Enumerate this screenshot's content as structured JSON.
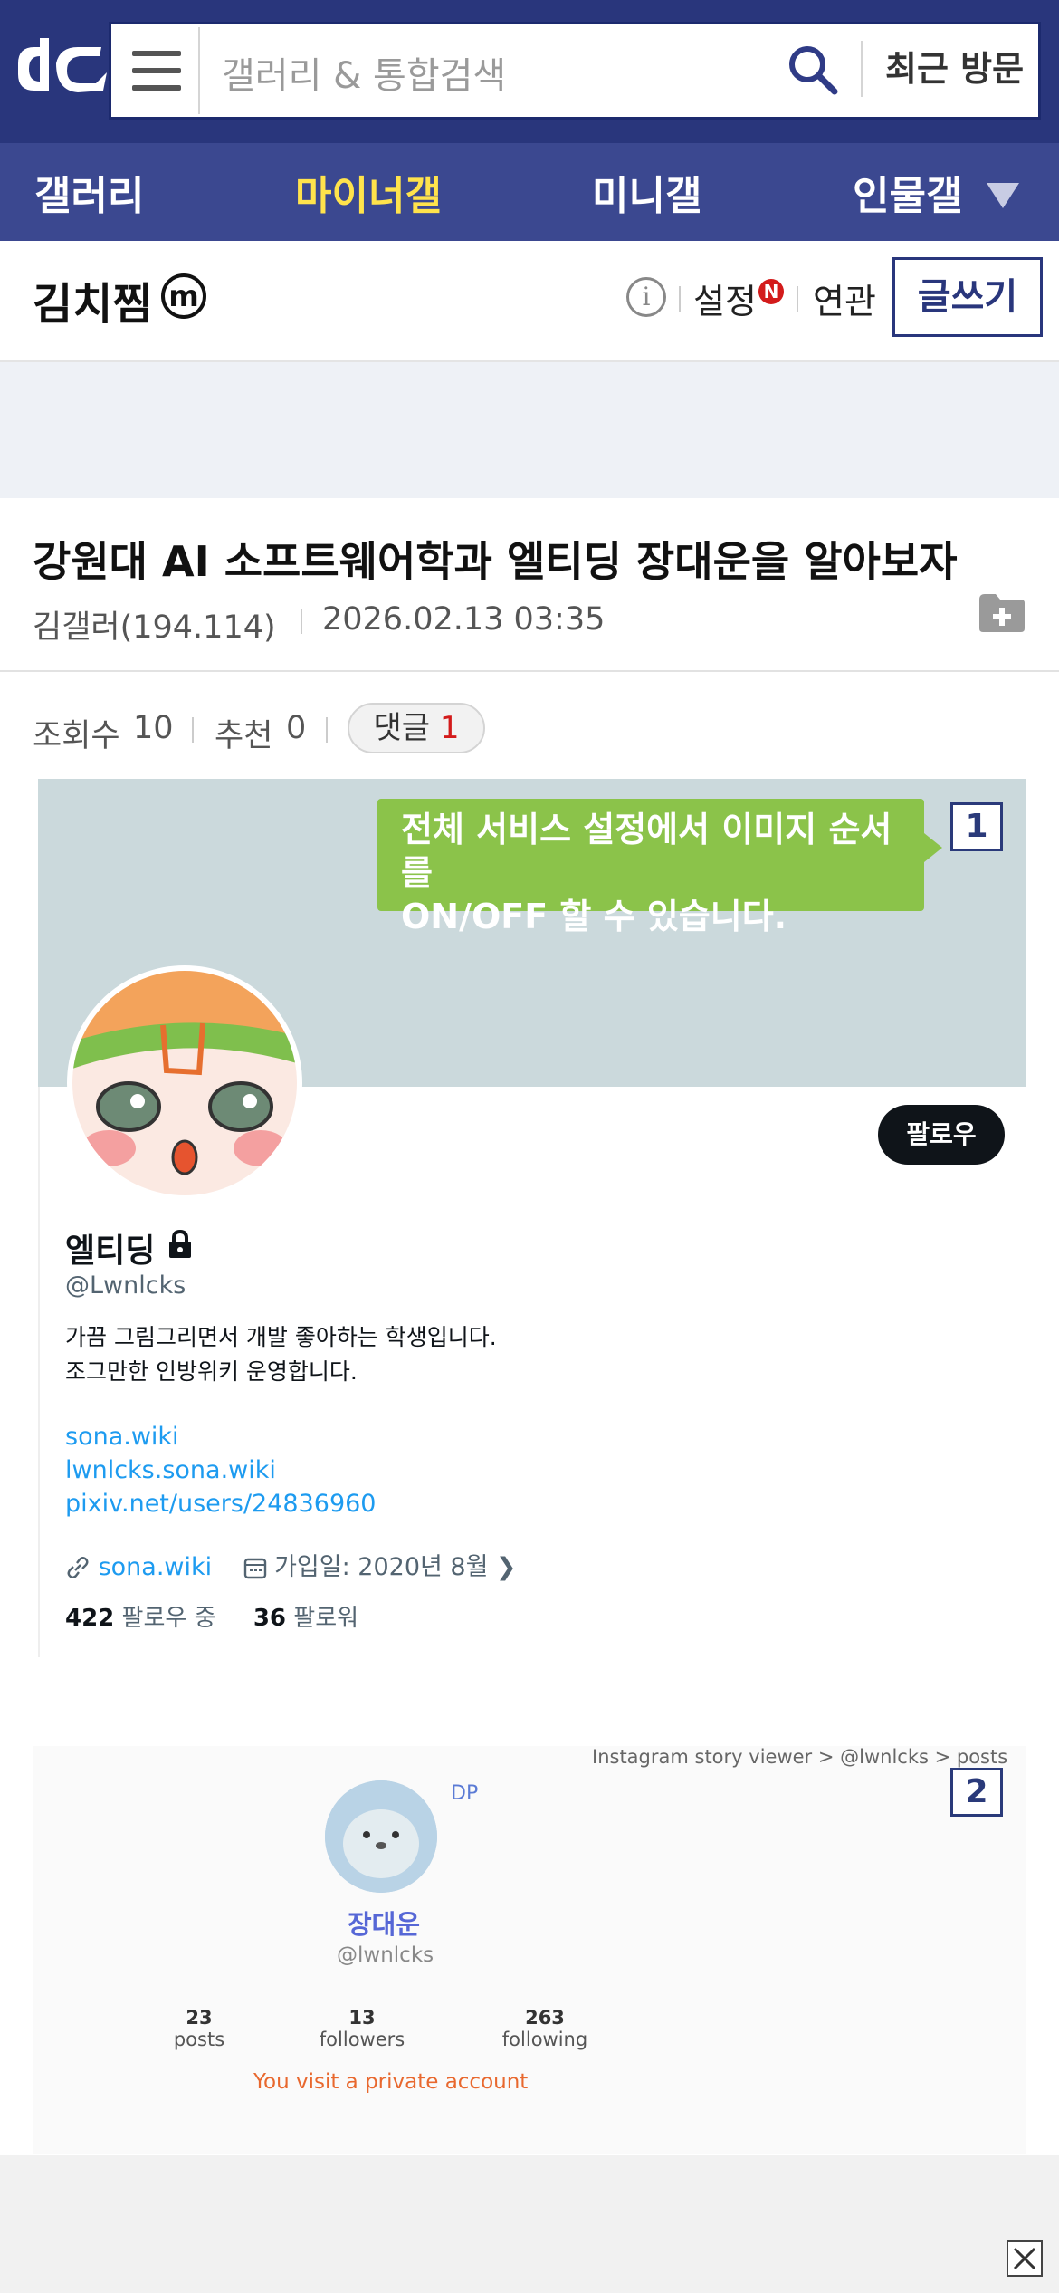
{
  "header": {
    "logo": "dc-logo",
    "search_placeholder": "갤러리 & 통합검색",
    "recent_label": "최근 방문"
  },
  "nav": {
    "items": [
      "갤러리",
      "마이너갤",
      "미니갤",
      "인물갤"
    ],
    "active": "마이너갤"
  },
  "gallery": {
    "title": "김치찜",
    "badge": "m",
    "settings_label": "설정",
    "settings_badge": "N",
    "related_label": "연관",
    "write_label": "글쓰기"
  },
  "post": {
    "title": "강원대 AI 소프트웨어학과 엘티딩 장대운을 알아보자",
    "author": "김갤러(194.114)",
    "date": "2026.02.13 03:35",
    "views_label": "조회수",
    "views": "10",
    "recommend_label": "추천",
    "recommend": "0",
    "comment_label": "댓글",
    "comment_count": "1"
  },
  "image1": {
    "badge": "1",
    "tooltip_line1": "전체 서비스 설정에서 이미지 순서를",
    "tooltip_line2": "ON/OFF 할 수 있습니다.",
    "follow_label": "팔로우",
    "name": "엘티딩",
    "handle": "@Lwnlcks",
    "bio_line1": "가끔 그림그리면서 개발 좋아하는 학생입니다.",
    "bio_line2": "조그만한 인방위키 운영합니다.",
    "links": [
      "sona.wiki",
      "lwnlcks.sona.wiki",
      "pixiv.net/users/24836960"
    ],
    "website": "sona.wiki",
    "joined": "가입일: 2020년 8월",
    "following_count": "422",
    "following_label": "팔로우 중",
    "followers_count": "36",
    "followers_label": "팔로워"
  },
  "image2": {
    "badge": "2",
    "breadcrumb": "Instagram story viewer  >  @lwnlcks  >  posts",
    "dp_label": "DP",
    "name": "장대운",
    "handle": "@lwnlcks",
    "stats": [
      {
        "value": "23",
        "label": "posts"
      },
      {
        "value": "13",
        "label": "followers"
      },
      {
        "value": "263",
        "label": "following"
      }
    ],
    "private_note": "You visit a private account"
  },
  "colors": {
    "header_bg": "#29367c",
    "nav_bg": "#3b4890",
    "nav_active": "#ffe34c",
    "tooltip": "#8bc34a",
    "link": "#1d9bf0",
    "comment_count": "#d31b1b"
  }
}
